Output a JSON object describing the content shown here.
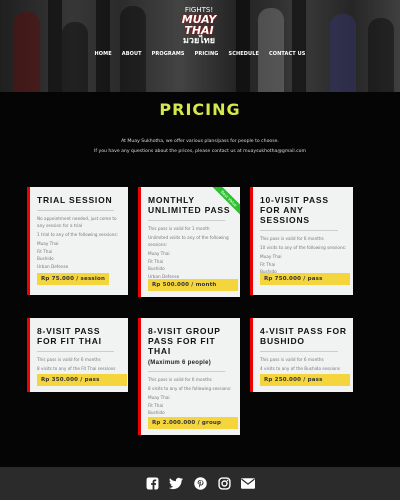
{
  "logo": {
    "word": "FIGHTS!",
    "brand": "MUAY THAI",
    "thai": "มวยไทย"
  },
  "nav": [
    "HOME",
    "ABOUT",
    "PROGRAMS",
    "PRICING",
    "SCHEDULE",
    "CONTACT US"
  ],
  "page_title": "PRICING",
  "intro": {
    "line1": "At Muay Sukhotha, we offer various plans/pass for people to choose.",
    "line2": "If you have any questions about the prices, please contact us at muaysukhotha@gmail.com"
  },
  "cards": [
    {
      "title": "TRIAL SESSION",
      "desc1": "No appointment needed, just come to any session for a trial",
      "desc2": "1 trial to any of the following sessions:",
      "items": [
        "Muay Thai",
        "Fit Thai",
        "Bushido",
        "Urban Defense"
      ],
      "price": "Rp 75.000 / session"
    },
    {
      "title": "MONTHLY UNLIMITED PASS",
      "ribbon": "Best Value",
      "desc1": "This pass is valid for 1 month",
      "desc2": "Unlimited visits to any of the following sessions:",
      "items": [
        "Muay Thai",
        "Fit Thai",
        "Bushido",
        "Urban Defense"
      ],
      "price": "Rp 500.000 / month"
    },
    {
      "title": "10-VISIT PASS FOR ANY SESSIONS",
      "desc1": "This pass is valid for 6 months",
      "desc2": "10 visits to any of the following sessions:",
      "items": [
        "Muay Thai",
        "Fit Thai",
        "Bushido",
        "Urban Defense"
      ],
      "price": "Rp 750.000 / pass"
    },
    {
      "title": "8-VISIT PASS FOR FIT THAI",
      "desc1": "This pass is valid for 6 months",
      "desc2": "8 visits to any of the Fit Thai sessions",
      "items": [],
      "price": "Rp 350.000 / pass"
    },
    {
      "title": "8-VISIT GROUP PASS FOR FIT THAI",
      "sub": "(Maximum 6 people)",
      "desc1": "This pass is valid for 6 months",
      "desc2": "8 visits to any of the following sessions:",
      "items": [
        "Muay Thai",
        "Fit Thai",
        "Bushido",
        "Urban Defense"
      ],
      "price": "Rp 2.000.000 / group"
    },
    {
      "title": "4-VISIT PASS FOR BUSHIDO",
      "desc1": "This pass is valid for 6 months",
      "desc2": "4 visits to any of the Bushido sessions",
      "items": [],
      "price": "Rp 250.000 / pass"
    }
  ],
  "social": [
    {
      "icon": "facebook-icon"
    },
    {
      "icon": "twitter-icon"
    },
    {
      "icon": "pinterest-icon"
    },
    {
      "icon": "instagram-icon"
    },
    {
      "icon": "email-icon"
    }
  ],
  "colors": {
    "accent": "#d7e84a",
    "card_border": "#ee0000",
    "price_bg": "#f4d53d",
    "ribbon": "#2ec02e",
    "footer_bg": "#2b2b2b"
  }
}
